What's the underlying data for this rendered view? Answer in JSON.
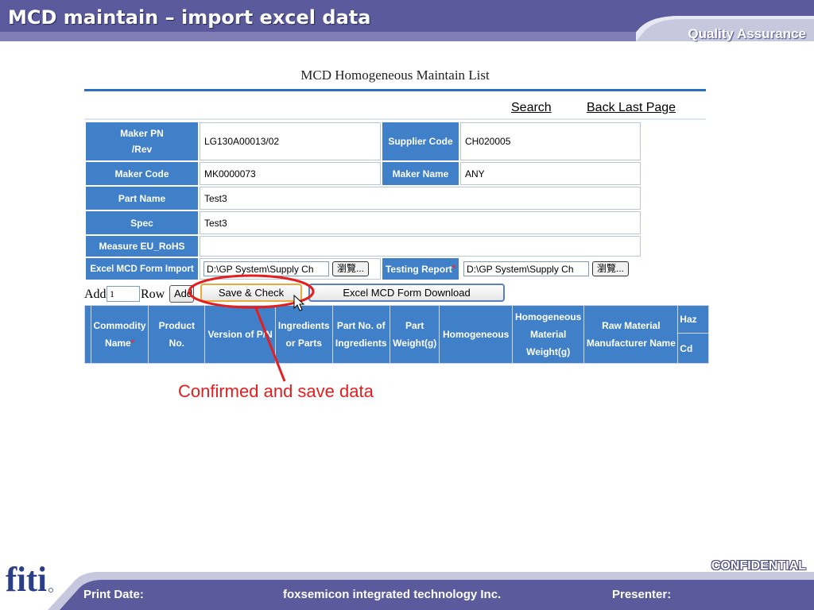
{
  "slide": {
    "title": "MCD maintain – import excel data",
    "subtitle": "Quality Assurance",
    "confidential": "CONFIDENTIAL",
    "footer": {
      "print_date_label": "Print Date:",
      "company": "foxsemicon integrated technology Inc.",
      "presenter_label": "Presenter:"
    },
    "logo_text": "fiti"
  },
  "screen": {
    "heading": "MCD Homogeneous Maintain List",
    "links": {
      "search": "Search",
      "back": "Back Last Page"
    },
    "form": {
      "maker_pn_label_1": "Maker PN",
      "maker_pn_label_2": "/Rev",
      "maker_pn_value": "LG130A00013/02",
      "supplier_code_label": "Supplier Code",
      "supplier_code_value": "CH020005",
      "maker_code_label": "Maker Code",
      "maker_code_value": "MK0000073",
      "maker_name_label": "Maker Name",
      "maker_name_value": "ANY",
      "part_name_label": "Part Name",
      "part_name_value": "Test3",
      "spec_label": "Spec",
      "spec_value": "Test3",
      "measure_label": "Measure EU_RoHS",
      "measure_value": "",
      "excel_import_label": "Excel MCD Form Import",
      "excel_import_value": "D:\\GP System\\Supply Ch",
      "browse_label": "瀏覽...",
      "testing_report_label": "Testing Report",
      "testing_report_value": "D:\\GP System\\Supply Ch",
      "required_mark": "*"
    },
    "add_row": {
      "add_text": "Add",
      "rows_value": "1",
      "row_text": "Row",
      "add_button": "Add",
      "save_check_button": "Save & Check",
      "download_button": "Excel MCD Form Download"
    },
    "grid": {
      "columns": {
        "commodity_1": "Commodity",
        "commodity_2": "Name",
        "product_no": "Product No.",
        "version": "Version of P/N",
        "ingredients_1": "Ingredients",
        "ingredients_2": "or Parts",
        "part_no_1": "Part No. of",
        "part_no_2": "Ingredients",
        "part_weight_1": "Part",
        "part_weight_2": "Weight(g)",
        "homogeneous": "Homogeneous",
        "hm_weight_1": "Homogeneous",
        "hm_weight_2": "Material",
        "hm_weight_3": "Weight(g)",
        "raw_1": "Raw Material",
        "raw_2": "Manufacturer Name",
        "haz": "Haz",
        "cd": "Cd"
      }
    },
    "callout": "Confirmed  and save data"
  },
  "colors": {
    "banner": "#5a5a9c",
    "header_cell": "#3f80c9",
    "callout": "#e41e1e"
  }
}
